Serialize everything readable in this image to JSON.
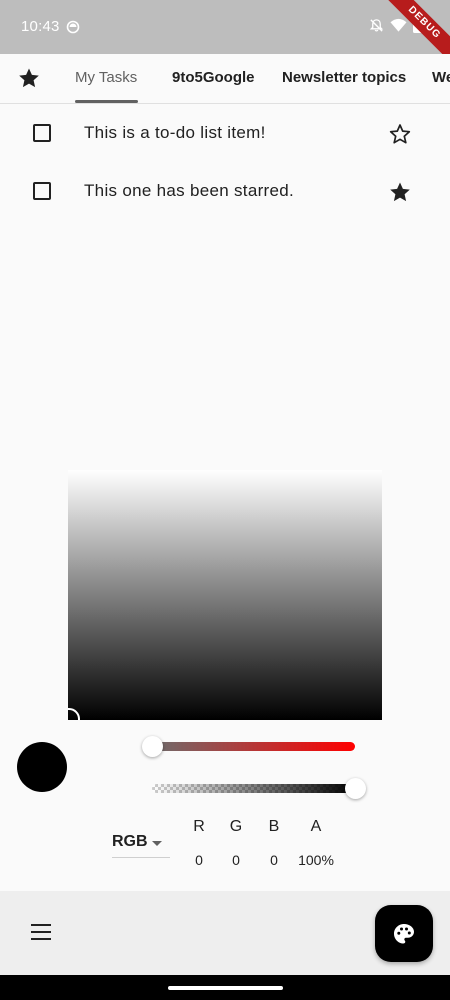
{
  "status_bar": {
    "time": "10:43",
    "debug_label": "DEBUG",
    "icons": [
      "app-notification-icon",
      "bell-off-icon",
      "wifi-icon",
      "battery-icon"
    ]
  },
  "tabs": {
    "leading_icon": "star-icon",
    "items": [
      {
        "label": "My Tasks",
        "active": true
      },
      {
        "label": "9to5Google",
        "active": false
      },
      {
        "label": "Newsletter topics",
        "active": false
      },
      {
        "label": "We",
        "active": false
      }
    ]
  },
  "tasks": [
    {
      "text": "This is a to-do list item!",
      "checked": false,
      "starred": false
    },
    {
      "text": "This one has been starred.",
      "checked": false,
      "starred": true
    }
  ],
  "color_picker": {
    "selected_color": "#000000",
    "mode": "RGB",
    "channels": [
      {
        "label": "R",
        "value": "0"
      },
      {
        "label": "G",
        "value": "0"
      },
      {
        "label": "B",
        "value": "0"
      },
      {
        "label": "A",
        "value": "100%"
      }
    ],
    "hue_slider_fraction": 0.0,
    "alpha_slider_fraction": 1.0
  },
  "bottom_bar": {
    "menu_icon": "menu-icon",
    "fab_icon": "palette-icon"
  },
  "colors": {
    "accent": "#616161",
    "red": "#ff0000",
    "background": "#fafafa",
    "status_bar": "#bdbdbd"
  }
}
